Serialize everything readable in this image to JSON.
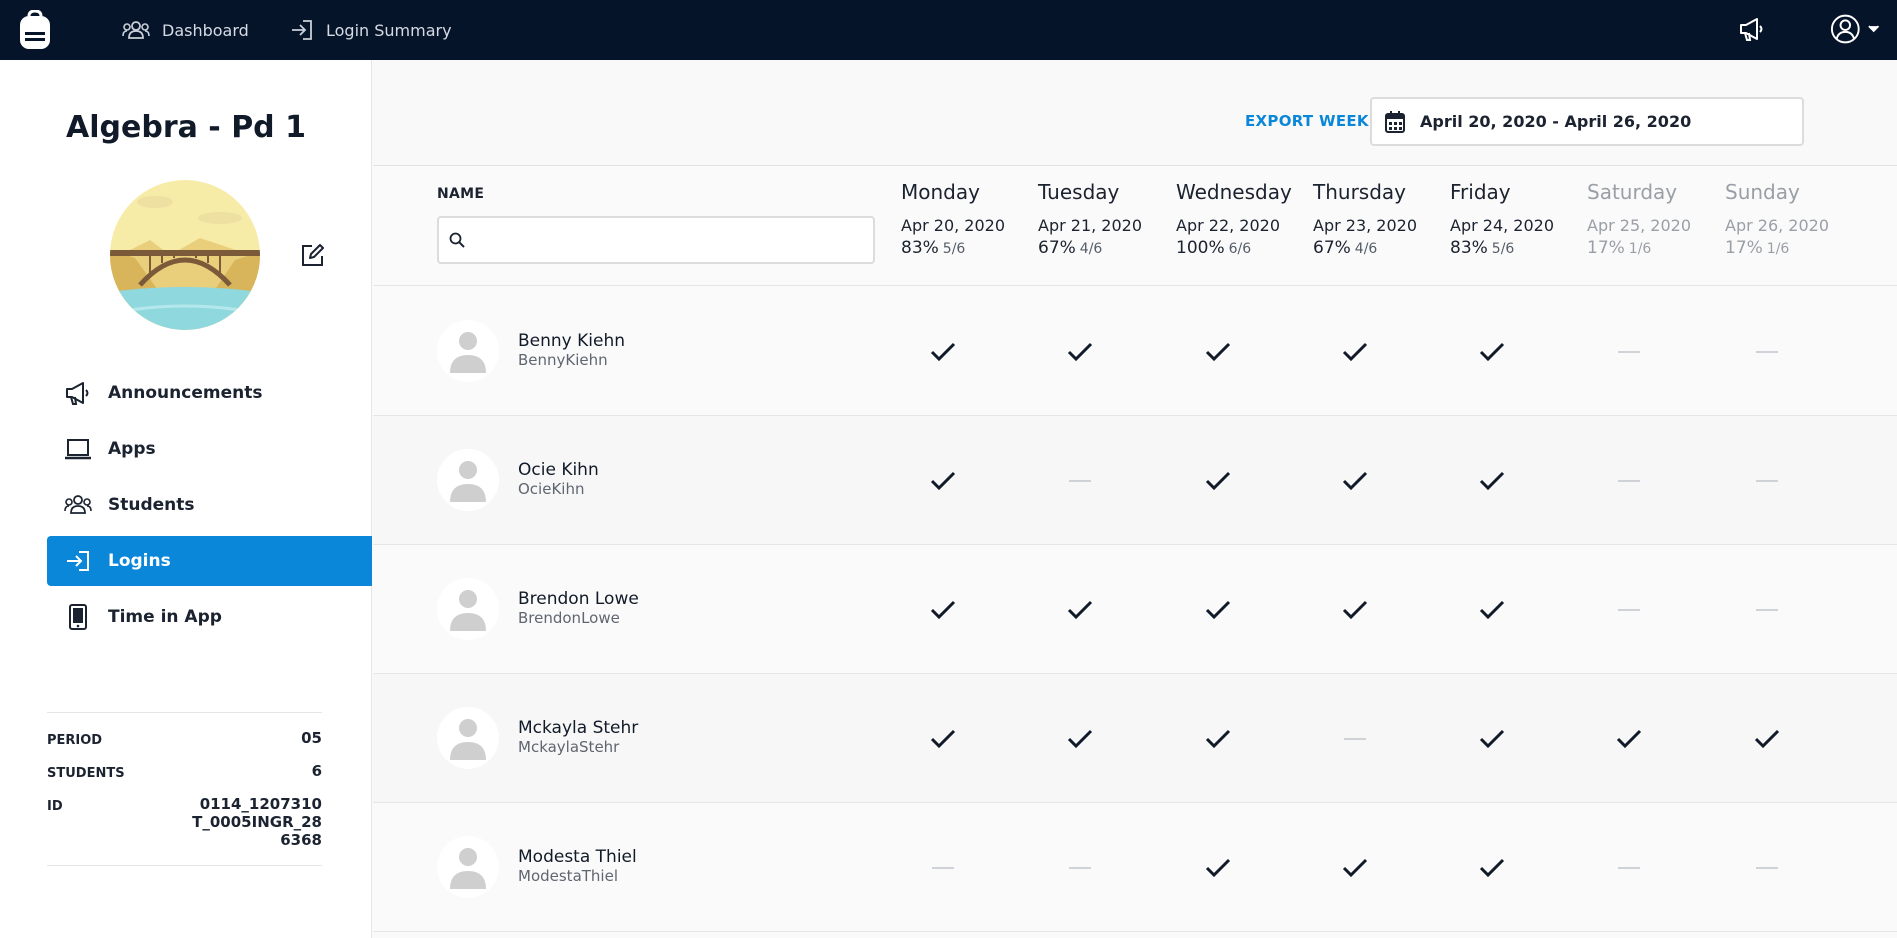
{
  "nav": {
    "dashboard": "Dashboard",
    "login_summary": "Login Summary"
  },
  "sidebar": {
    "class_title": "Algebra - Pd 1",
    "menu": [
      {
        "label": "Announcements",
        "icon": "megaphone-icon"
      },
      {
        "label": "Apps",
        "icon": "laptop-icon"
      },
      {
        "label": "Students",
        "icon": "users-icon"
      },
      {
        "label": "Logins",
        "icon": "login-icon",
        "active": true
      },
      {
        "label": "Time in App",
        "icon": "tablet-icon"
      }
    ],
    "info": {
      "period_label": "PERIOD",
      "period_value": "05",
      "students_label": "STUDENTS",
      "students_value": "6",
      "id_label": "ID",
      "id_value": "0114_1207310T_0005INGR_286368"
    }
  },
  "toolbar": {
    "export_label": "EXPORT WEEK",
    "date_range": "April 20, 2020 - April 26, 2020"
  },
  "table": {
    "name_header": "NAME",
    "search_placeholder": "",
    "days": [
      {
        "name": "Monday",
        "date": "Apr 20, 2020",
        "pct": "83%",
        "frac": "5/6",
        "weekend": false
      },
      {
        "name": "Tuesday",
        "date": "Apr 21, 2020",
        "pct": "67%",
        "frac": "4/6",
        "weekend": false
      },
      {
        "name": "Wednesday",
        "date": "Apr 22, 2020",
        "pct": "100%",
        "frac": "6/6",
        "weekend": false
      },
      {
        "name": "Thursday",
        "date": "Apr 23, 2020",
        "pct": "67%",
        "frac": "4/6",
        "weekend": false
      },
      {
        "name": "Friday",
        "date": "Apr 24, 2020",
        "pct": "83%",
        "frac": "5/6",
        "weekend": false
      },
      {
        "name": "Saturday",
        "date": "Apr 25, 2020",
        "pct": "17%",
        "frac": "1/6",
        "weekend": true
      },
      {
        "name": "Sunday",
        "date": "Apr 26, 2020",
        "pct": "17%",
        "frac": "1/6",
        "weekend": true
      }
    ],
    "students": [
      {
        "name": "Benny Kiehn",
        "username": "BennyKiehn",
        "logins": [
          true,
          true,
          true,
          true,
          true,
          false,
          false
        ]
      },
      {
        "name": "Ocie Kihn",
        "username": "OcieKihn",
        "logins": [
          true,
          false,
          true,
          true,
          true,
          false,
          false
        ]
      },
      {
        "name": "Brendon Lowe",
        "username": "BrendonLowe",
        "logins": [
          true,
          true,
          true,
          true,
          true,
          false,
          false
        ]
      },
      {
        "name": "Mckayla Stehr",
        "username": "MckaylaStehr",
        "logins": [
          true,
          true,
          true,
          false,
          true,
          true,
          true
        ]
      },
      {
        "name": "Modesta Thiel",
        "username": "ModestaThiel",
        "logins": [
          false,
          false,
          true,
          true,
          true,
          false,
          false
        ]
      }
    ]
  },
  "colors": {
    "topbar": "#06142a",
    "accent": "#0a87d8"
  }
}
